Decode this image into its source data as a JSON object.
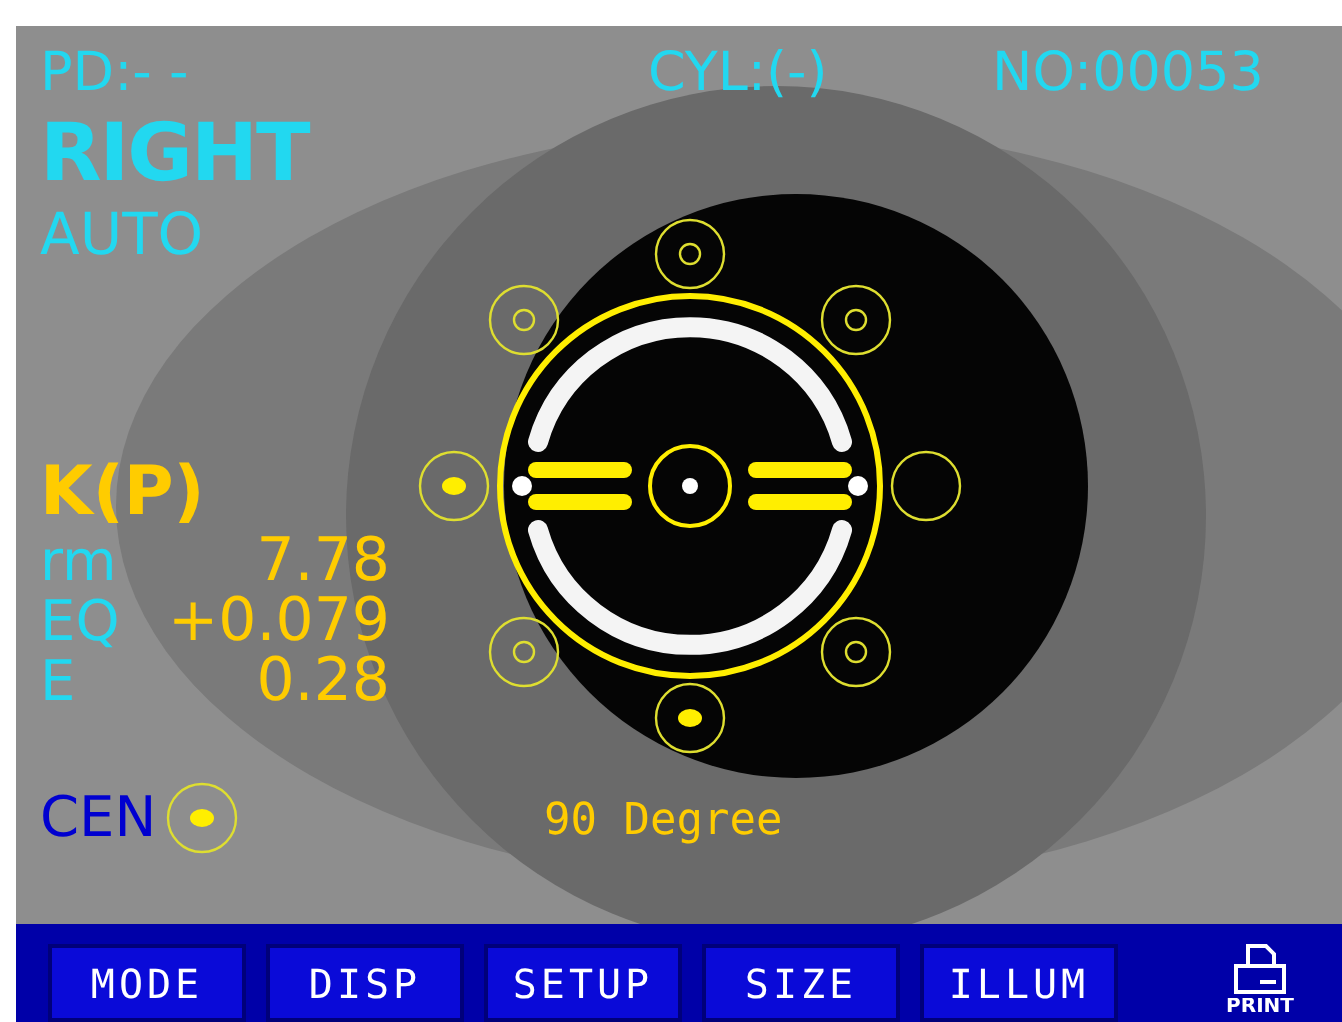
{
  "header": {
    "pd": "PD:- -",
    "cyl": "CYL:(-)",
    "number": "NO:00053",
    "eye": "RIGHT",
    "mode": "AUTO"
  },
  "keratometry": {
    "title": "K(P)",
    "readings": [
      {
        "label": "rm",
        "value": "7.78"
      },
      {
        "label": "EQ",
        "value": "+0.079"
      },
      {
        "label": "E",
        "value": "0.28"
      }
    ]
  },
  "alignment_marks": [
    {
      "kind": "ring"
    },
    {
      "kind": "ring"
    },
    {
      "kind": "ring"
    },
    {
      "kind": "dot"
    },
    {
      "kind": "empty"
    },
    {
      "kind": "ring"
    },
    {
      "kind": "ring"
    },
    {
      "kind": "dot"
    }
  ],
  "center": {
    "label": "CEN",
    "kind": "dot"
  },
  "angle": "90 Degree",
  "buttons": [
    "MODE",
    "DISP",
    "SETUP",
    "SIZE",
    "ILLUM"
  ],
  "print_label": "PRINT"
}
